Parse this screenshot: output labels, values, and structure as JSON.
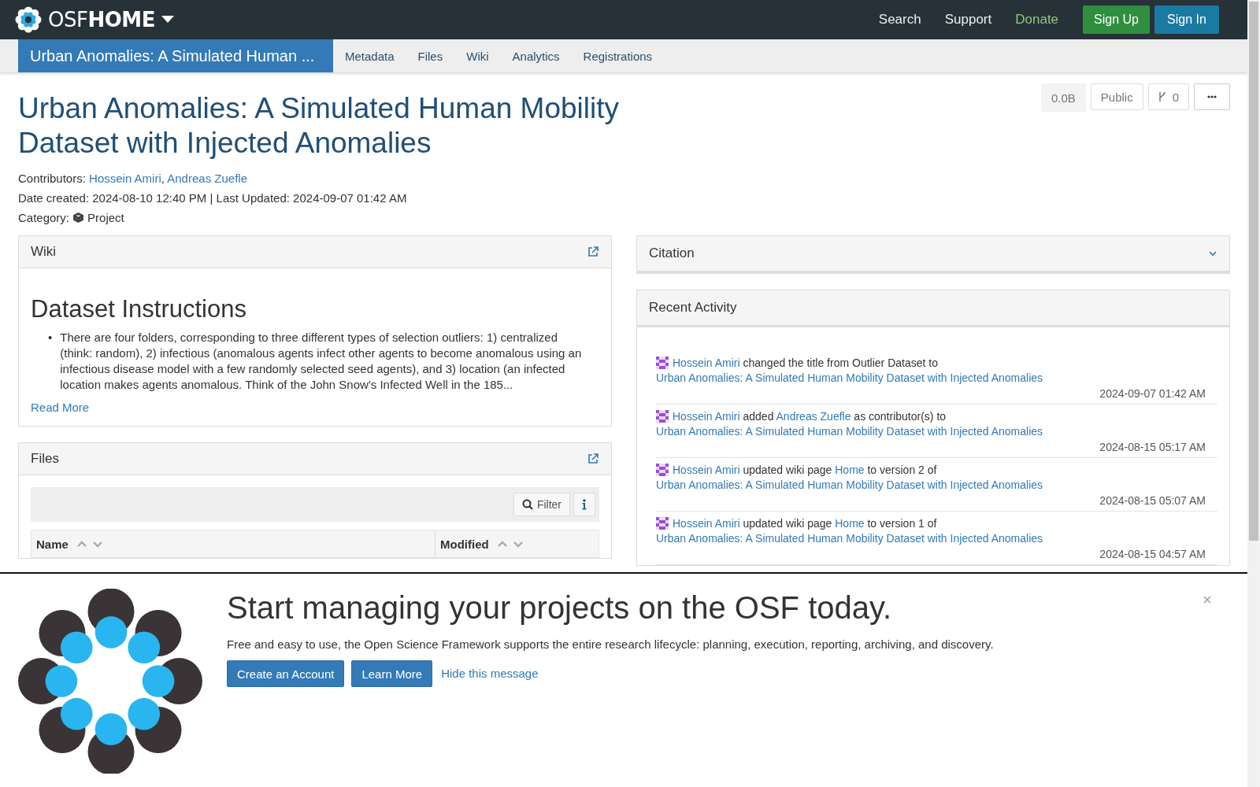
{
  "navbar": {
    "brand_light": "OSF",
    "brand_bold": "HOME",
    "links": [
      {
        "label": "Search",
        "kind": "plain"
      },
      {
        "label": "Support",
        "kind": "plain"
      },
      {
        "label": "Donate",
        "kind": "donate"
      }
    ],
    "buttons": [
      {
        "label": "Sign Up",
        "kind": "success"
      },
      {
        "label": "Sign In",
        "kind": "primary"
      }
    ]
  },
  "project_nav": {
    "tabs": [
      {
        "label": "Urban Anomalies: A Simulated Human ...",
        "selected": true
      },
      {
        "label": "Metadata",
        "selected": false
      },
      {
        "label": "Files",
        "selected": false
      },
      {
        "label": "Wiki",
        "selected": false
      },
      {
        "label": "Analytics",
        "selected": false
      },
      {
        "label": "Registrations",
        "selected": false
      }
    ]
  },
  "header": {
    "title": "Urban Anomalies: A Simulated Human Mobility Dataset with Injected Anomalies",
    "badges": [
      {
        "kind": "size",
        "label": "0.0B"
      },
      {
        "kind": "plain",
        "label": "Public"
      },
      {
        "kind": "fork",
        "label": "0"
      },
      {
        "kind": "more"
      }
    ]
  },
  "contributors": [
    {
      "kind": "text",
      "text": "Contributors: "
    },
    {
      "kind": "link",
      "text": "Hossein Amiri"
    },
    {
      "kind": "text",
      "text": ", "
    },
    {
      "kind": "link",
      "text": "Andreas Zuefle"
    }
  ],
  "dates": "Date created: 2024-08-10 12:40 PM | Last Updated: 2024-09-07 01:42 AM",
  "category": {
    "label": "Category:",
    "value": "Project"
  },
  "wiki": {
    "title": "Wiki",
    "heading": "Dataset Instructions",
    "marker": "•",
    "bullets": [
      "There are four folders, corresponding to three different types of selection outliers: 1) centralized (think: random), 2) infectious (anomalous agents infect other agents to become anomalous using an infectious disease model with a few randomly selected seed agents), and 3) location (an infected location makes agents anomalous. Think of the John Snow's Infected Well in the 185..."
    ],
    "read_more": "Read More"
  },
  "files": {
    "title": "Files",
    "filter": "Filter",
    "columns": [
      "Name",
      "Modified"
    ]
  },
  "citation": {
    "title": "Citation"
  },
  "recent_activity": {
    "title": "Recent Activity",
    "items": [
      {
        "parts": [
          {
            "kind": "link",
            "text": "Hossein Amiri"
          },
          {
            "kind": "text",
            "text": " changed the title from Outlier Dataset to "
          },
          {
            "kind": "link",
            "text": "Urban Anomalies: A Simulated Human Mobility Dataset with Injected Anomalies"
          }
        ],
        "time": "2024-09-07 01:42 AM"
      },
      {
        "parts": [
          {
            "kind": "link",
            "text": "Hossein Amiri"
          },
          {
            "kind": "text",
            "text": " added "
          },
          {
            "kind": "link",
            "text": "Andreas Zuefle"
          },
          {
            "kind": "text",
            "text": " as contributor(s) to "
          },
          {
            "kind": "link",
            "text": "Urban Anomalies: A Simulated Human Mobility Dataset with Injected Anomalies"
          }
        ],
        "time": "2024-08-15 05:17 AM"
      },
      {
        "parts": [
          {
            "kind": "link",
            "text": "Hossein Amiri"
          },
          {
            "kind": "text",
            "text": " updated wiki page "
          },
          {
            "kind": "link",
            "text": "Home"
          },
          {
            "kind": "text",
            "text": " to version 2 of "
          },
          {
            "kind": "link",
            "text": "Urban Anomalies: A Simulated Human Mobility Dataset with Injected Anomalies"
          }
        ],
        "time": "2024-08-15 05:07 AM"
      },
      {
        "parts": [
          {
            "kind": "link",
            "text": "Hossein Amiri"
          },
          {
            "kind": "text",
            "text": " updated wiki page "
          },
          {
            "kind": "link",
            "text": "Home"
          },
          {
            "kind": "text",
            "text": " to version 1 of "
          },
          {
            "kind": "link",
            "text": "Urban Anomalies: A Simulated Human Mobility Dataset with Injected Anomalies"
          }
        ],
        "time": "2024-08-15 04:57 AM"
      }
    ]
  },
  "banner": {
    "headline": "Start managing your projects on the OSF today.",
    "text": "Free and easy to use, the Open Science Framework supports the entire research lifecycle: planning, execution, reporting, archiving, and discovery.",
    "buttons": [
      "Create an Account",
      "Learn More"
    ],
    "link": "Hide this message"
  }
}
